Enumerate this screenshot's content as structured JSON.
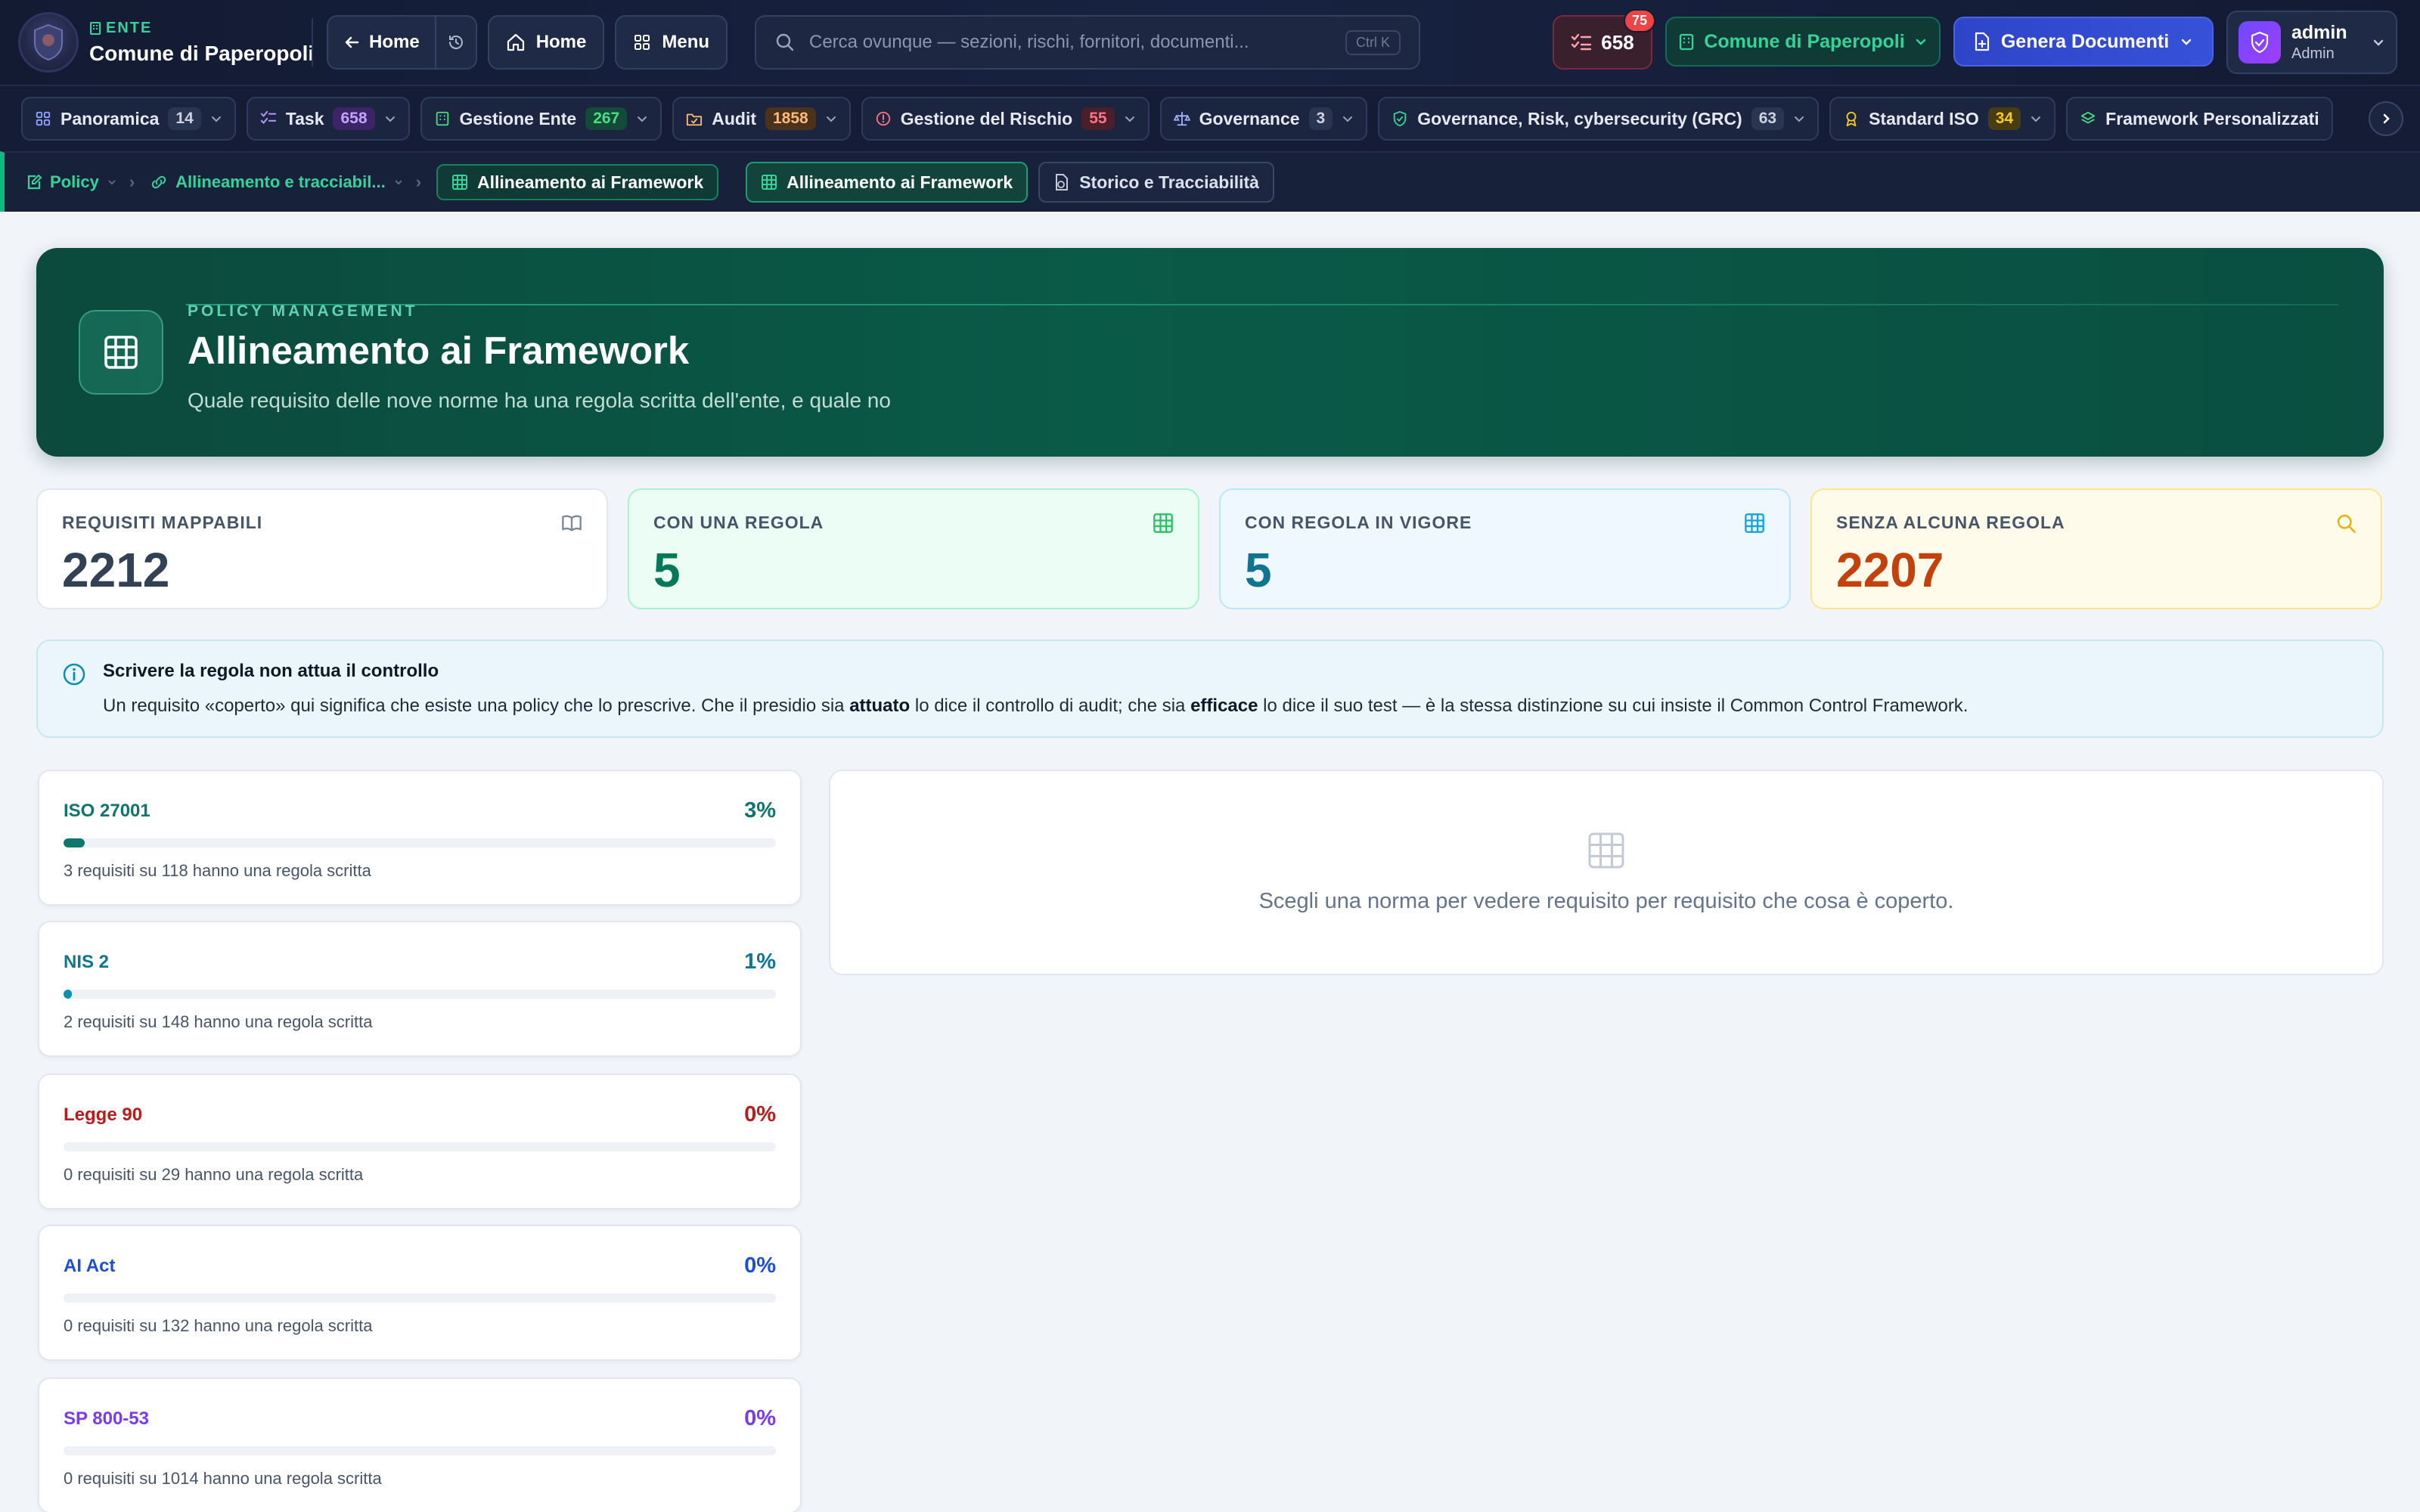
{
  "topbar": {
    "org_kicker": "ENTE",
    "org_name": "Comune di Paperopoli",
    "back_label": "Home",
    "home_label": "Home",
    "menu_label": "Menu",
    "search_placeholder": "Cerca ovunque — sezioni, rischi, fornitori, documenti...",
    "search_shortcut": "Ctrl K",
    "task_count": "658",
    "notification_count": "75",
    "org_selector": "Comune di Paperopoli",
    "generate_docs": "Genera Documenti",
    "user_name": "admin",
    "user_role": "Admin"
  },
  "nav": {
    "items": [
      {
        "label": "Panoramica",
        "count": "14",
        "icon": "grid-icon",
        "count_bg": "#2a3552",
        "count_fg": "#cdd3e1"
      },
      {
        "label": "Task",
        "count": "658",
        "icon": "checklist-icon",
        "count_bg": "#3b2566",
        "count_fg": "#c4a2ff"
      },
      {
        "label": "Gestione Ente",
        "count": "267",
        "icon": "building-icon",
        "count_bg": "#134a3a",
        "count_fg": "#4ade80"
      },
      {
        "label": "Audit",
        "count": "1858",
        "icon": "folder-check-icon",
        "count_bg": "#4a321c",
        "count_fg": "#fdba74"
      },
      {
        "label": "Gestione del Rischio",
        "count": "55",
        "icon": "alert-circle-icon",
        "count_bg": "#4a1f2a",
        "count_fg": "#fb7185"
      },
      {
        "label": "Governance",
        "count": "3",
        "icon": "scale-icon",
        "count_bg": "#2a3552",
        "count_fg": "#cdd3e1"
      },
      {
        "label": "Governance, Risk, cybersecurity (GRC)",
        "count": "63",
        "icon": "shield-check-icon",
        "count_bg": "#2a3552",
        "count_fg": "#cdd3e1"
      },
      {
        "label": "Standard ISO",
        "count": "34",
        "icon": "award-icon",
        "count_bg": "#4a3c12",
        "count_fg": "#facc15"
      },
      {
        "label": "Framework Personalizzati",
        "count": "",
        "icon": "layers-icon",
        "count_bg": "",
        "count_fg": ""
      }
    ]
  },
  "breadcrumb": {
    "policy": "Policy",
    "alignment": "Allineamento e tracciabil...",
    "current": "Allineamento ai Framework",
    "tab_active": "Allineamento ai Framework",
    "tab_history": "Storico e Tracciabilità"
  },
  "hero": {
    "kicker": "POLICY MANAGEMENT",
    "title": "Allineamento ai Framework",
    "subtitle": "Quale requisito delle nove norme ha una regola scritta dell'ente, e quale no"
  },
  "stats": [
    {
      "label": "Requisiti mappabili",
      "value": "2212",
      "icon": "book-icon",
      "color": "#334155",
      "bg": "#ffffff",
      "border": "#e3e8ef",
      "label_color": "#475569"
    },
    {
      "label": "Con una regola",
      "value": "5",
      "icon": "table-icon",
      "color": "#047857",
      "bg": "#ecfdf5",
      "border": "#a7f3d0",
      "label_color": "#475569"
    },
    {
      "label": "Con regola in vigore",
      "value": "5",
      "icon": "table-icon",
      "color": "#0e7490",
      "bg": "#eff8ff",
      "border": "#bae6fd",
      "label_color": "#475569"
    },
    {
      "label": "Senza alcuna regola",
      "value": "2207",
      "icon": "search-icon",
      "color": "#c2410c",
      "bg": "#fffbeb",
      "border": "#fde68a",
      "label_color": "#475569"
    }
  ],
  "info": {
    "title": "Scrivere la regola non attua il controllo",
    "text_1": "Un requisito «coperto» qui significa che esiste una policy che lo prescrive. Che il presidio sia ",
    "bold_1": "attuato",
    "text_2": " lo dice il controllo di audit; che sia ",
    "bold_2": "efficace",
    "text_3": " lo dice il suo test — è la stessa distinzione su cui insiste il Common Control Framework."
  },
  "frameworks": [
    {
      "name": "ISO 27001",
      "pct": "3%",
      "fraction": 0.03,
      "note": "3 requisiti su 118 hanno una regola scritta",
      "color": "#0f766e",
      "bar": "#0f766e"
    },
    {
      "name": "NIS 2",
      "pct": "1%",
      "fraction": 0.01,
      "note": "2 requisiti su 148 hanno una regola scritta",
      "color": "#0e7490",
      "bar": "#0891b2"
    },
    {
      "name": "Legge 90",
      "pct": "0%",
      "fraction": 0,
      "note": "0 requisiti su 29 hanno una regola scritta",
      "color": "#b91c1c",
      "bar": "#b91c1c"
    },
    {
      "name": "AI Act",
      "pct": "0%",
      "fraction": 0,
      "note": "0 requisiti su 132 hanno una regola scritta",
      "color": "#1d4ed8",
      "bar": "#1d4ed8"
    },
    {
      "name": "SP 800-53",
      "pct": "0%",
      "fraction": 0,
      "note": "0 requisiti su 1014 hanno una regola scritta",
      "color": "#7c3aed",
      "bar": "#7c3aed"
    }
  ],
  "detail": {
    "empty_text": "Scegli una norma per vedere requisito per requisito che cosa è coperto."
  }
}
